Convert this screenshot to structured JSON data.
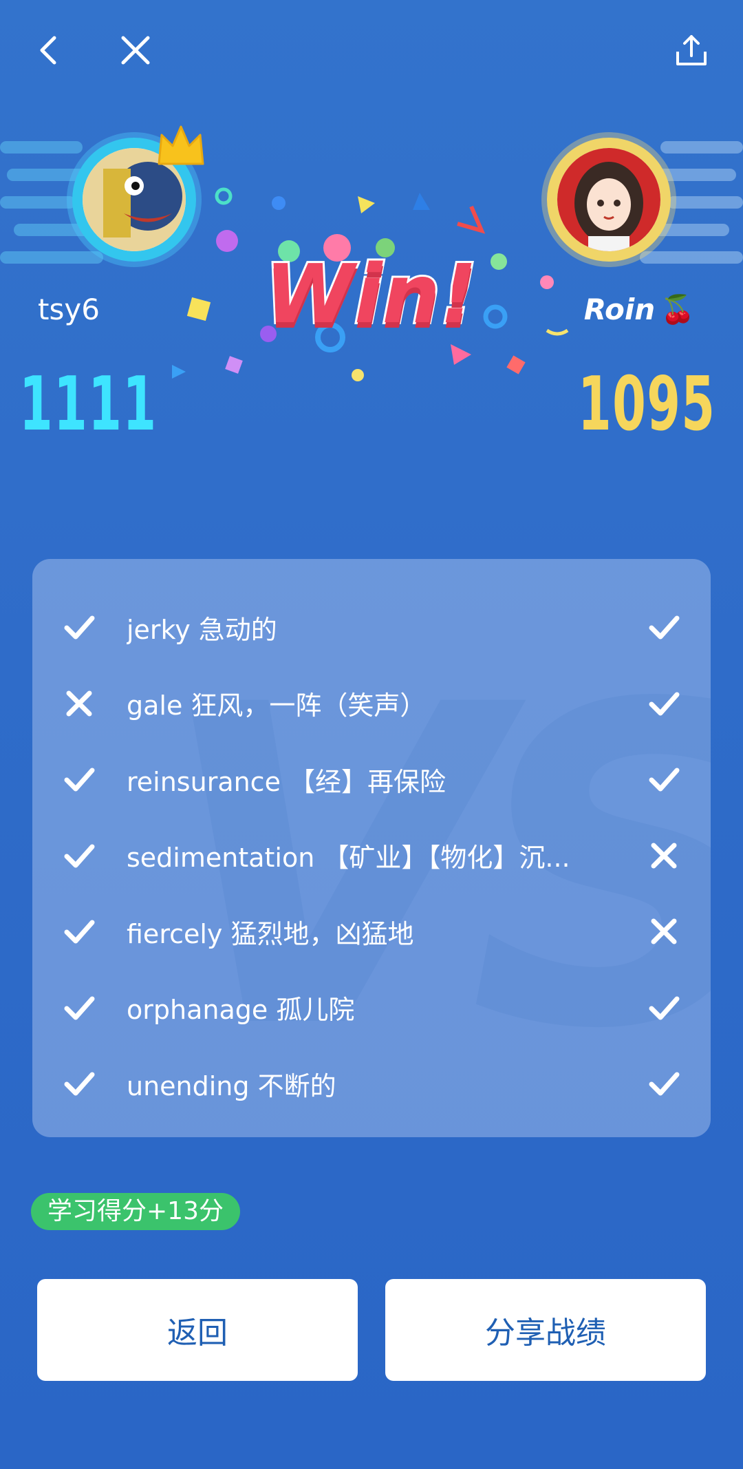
{
  "topbar": {
    "back_icon": "chevron-left-icon",
    "close_icon": "close-icon",
    "share_icon": "share-icon"
  },
  "header": {
    "result_text": "Win!",
    "left_player": {
      "name": "tsy6",
      "score": "1111",
      "avatar": "robot-avatar",
      "crown": "crown-icon",
      "color": "#3ee4ff"
    },
    "right_player": {
      "name": "Roin",
      "emoji": "🍒",
      "score": "1095",
      "avatar": "girl-avatar",
      "color": "#f6d65c"
    }
  },
  "card": {
    "watermark": "VS",
    "rows": [
      {
        "word": "jerky 急动的",
        "left": "correct",
        "right": "correct"
      },
      {
        "word": "gale 狂风，一阵（笑声）",
        "left": "wrong",
        "right": "correct"
      },
      {
        "word": "reinsurance 【经】再保险",
        "left": "correct",
        "right": "correct"
      },
      {
        "word": "sedimentation 【矿业】【物化】沉...",
        "left": "correct",
        "right": "wrong"
      },
      {
        "word": "fiercely 猛烈地，凶猛地",
        "left": "correct",
        "right": "wrong"
      },
      {
        "word": "orphanage 孤儿院",
        "left": "correct",
        "right": "correct"
      },
      {
        "word": "unending 不断的",
        "left": "correct",
        "right": "correct"
      }
    ]
  },
  "badge": {
    "label": "学习得分+13分",
    "color": "#3bc36c"
  },
  "buttons": {
    "back_label": "返回",
    "share_label": "分享战绩"
  },
  "colors": {
    "background": "#3170ca",
    "accent_blue": "#1f5fb3"
  }
}
